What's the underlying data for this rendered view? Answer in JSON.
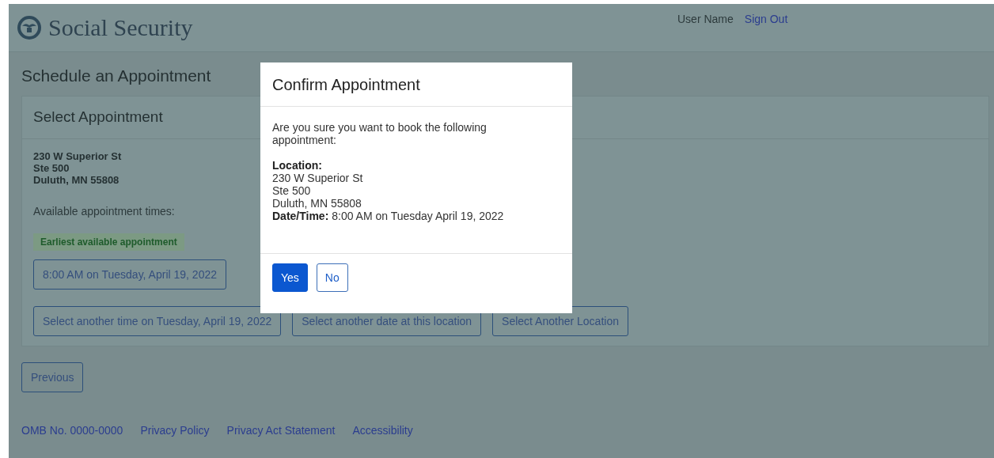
{
  "header": {
    "logo_text": "Social Security",
    "user_name": "User Name",
    "sign_out": "Sign Out"
  },
  "page_title": "Schedule an Appointment",
  "card": {
    "title": "Select Appointment",
    "address": [
      "230 W Superior St",
      "Ste 500",
      "Duluth, MN  55808"
    ],
    "times_label": "Available appointment times:",
    "badge": "Earliest available appointment",
    "time_button": "8:00 AM on Tuesday, April 19, 2022",
    "actions": [
      "Select another time on Tuesday, April 19, 2022",
      "Select another date at this location",
      "Select  Another Location"
    ]
  },
  "previous_button": "Previous",
  "footer_links": [
    "OMB No. 0000-0000",
    "Privacy Policy",
    "Privacy Act Statement",
    "Accessibility"
  ],
  "modal": {
    "title": "Confirm Appointment",
    "question": "Are you sure you want to book the following appointment:",
    "location_label": "Location:",
    "location_lines": [
      "230 W Superior St",
      "Ste 500",
      "Duluth, MN  55808"
    ],
    "datetime_label": "Date/Time:",
    "datetime_value": "8:00 AM on Tuesday April 19, 2022",
    "buttons": [
      {
        "label": "Yes",
        "kind": "primary"
      },
      {
        "label": "No",
        "kind": "secondary"
      }
    ]
  }
}
